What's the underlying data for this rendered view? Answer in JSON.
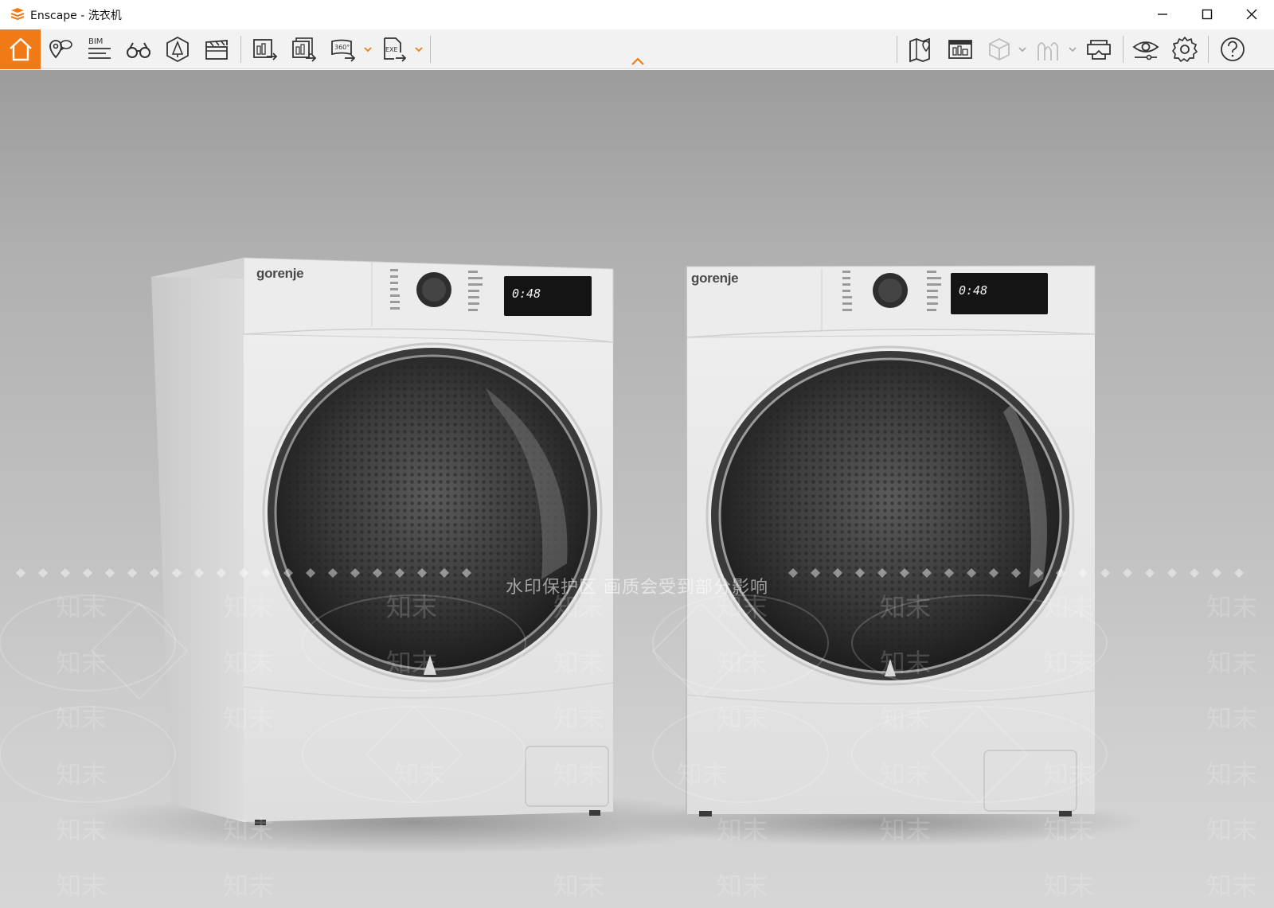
{
  "window": {
    "title": "Enscape - 洗衣机"
  },
  "toolbar": {
    "buttons": [
      {
        "id": "home",
        "icon": "home-icon"
      },
      {
        "id": "views",
        "icon": "map-pin-icon"
      },
      {
        "id": "bim",
        "icon": "bim-icon",
        "label": "BIM"
      },
      {
        "id": "walk",
        "icon": "binoculars-icon"
      },
      {
        "id": "assets",
        "icon": "asset-library-icon"
      },
      {
        "id": "video",
        "icon": "clapperboard-icon"
      },
      {
        "id": "render-image",
        "icon": "render-image-icon"
      },
      {
        "id": "batch-render",
        "icon": "batch-render-icon"
      },
      {
        "id": "pano",
        "icon": "panorama-360-icon",
        "label": "360°"
      },
      {
        "id": "exe",
        "icon": "export-exe-icon",
        "label": "EXE"
      },
      {
        "id": "map",
        "icon": "map-view-icon"
      },
      {
        "id": "materials",
        "icon": "material-editor-icon"
      },
      {
        "id": "cube",
        "icon": "cube-icon"
      },
      {
        "id": "mountains",
        "icon": "sky-icon"
      },
      {
        "id": "vr",
        "icon": "vr-headset-icon"
      },
      {
        "id": "visual",
        "icon": "eye-icon"
      },
      {
        "id": "settings",
        "icon": "gear-icon"
      },
      {
        "id": "help",
        "icon": "help-icon"
      }
    ],
    "accent": "#f07b16"
  },
  "scene": {
    "left_machine": {
      "brand": "gorenje",
      "time": "0:48"
    },
    "right_machine": {
      "brand": "gorenje",
      "time": "0:48"
    },
    "watermark_band": "水印保护区   画质会受到部分影响",
    "watermark_mark": "知末"
  }
}
